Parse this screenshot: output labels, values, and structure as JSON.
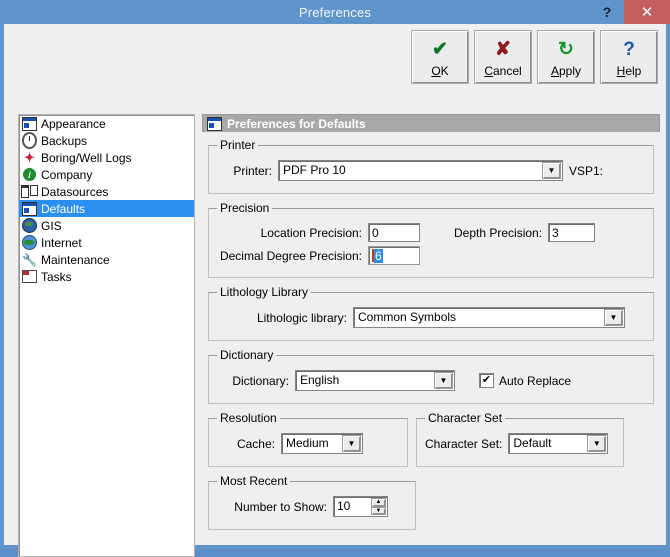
{
  "window": {
    "title": "Preferences",
    "help_glyph": "?",
    "close_glyph": "✕",
    "accent_title_bg": "#6094cb",
    "close_bg": "#c45f5f"
  },
  "toolbar": {
    "buttons": [
      {
        "name": "ok",
        "glyph": "✔",
        "pre": "O",
        "accel": "K",
        "post": "",
        "color": "#0a7a28"
      },
      {
        "name": "cancel",
        "glyph": "✘",
        "pre": "",
        "accel": "C",
        "post": "ancel",
        "color": "#8e1b1b"
      },
      {
        "name": "apply",
        "glyph": "↻",
        "pre": "",
        "accel": "A",
        "post": "pply",
        "color": "#18962f"
      },
      {
        "name": "help",
        "glyph": "?",
        "pre": "",
        "accel": "H",
        "post": "elp",
        "color": "#1b56b8"
      }
    ],
    "labels": {
      "ok": "OK",
      "cancel": "Cancel",
      "apply": "Apply",
      "help": "Help"
    }
  },
  "sidebar": {
    "selected": "Defaults",
    "selection_color": "#2a8fef",
    "items": [
      {
        "label": "Appearance",
        "icon": "window-icon"
      },
      {
        "label": "Backups",
        "icon": "clock-icon"
      },
      {
        "label": "Boring/Well Logs",
        "icon": "star-icon"
      },
      {
        "label": "Company",
        "icon": "info-circle-icon"
      },
      {
        "label": "Datasources",
        "icon": "datasources-icon"
      },
      {
        "label": "Defaults",
        "icon": "window-icon"
      },
      {
        "label": "GIS",
        "icon": "globe-icon"
      },
      {
        "label": "Internet",
        "icon": "globe-internet-icon"
      },
      {
        "label": "Maintenance",
        "icon": "wrench-icon"
      },
      {
        "label": "Tasks",
        "icon": "task-icon"
      }
    ]
  },
  "panel": {
    "header": "Preferences for Defaults",
    "printer": {
      "legend": "Printer",
      "label": "Printer:",
      "value": "PDF Pro 10",
      "port": "VSP1:"
    },
    "precision": {
      "legend": "Precision",
      "location_label": "Location Precision:",
      "location_value": "0",
      "depth_label": "Depth Precision:",
      "depth_value": "3",
      "decimal_label": "Decimal Degree Precision:",
      "decimal_value": "6"
    },
    "lithology": {
      "legend": "Lithology Library",
      "label": "Lithologic library:",
      "value": "Common Symbols"
    },
    "dictionary": {
      "legend": "Dictionary",
      "label": "Dictionary:",
      "value": "English",
      "auto_replace_label": "Auto Replace",
      "auto_replace_checked": "✔"
    },
    "resolution": {
      "legend": "Resolution",
      "label": "Cache:",
      "value": "Medium"
    },
    "character_set": {
      "legend": "Character Set",
      "label": "Character Set:",
      "value": "Default"
    },
    "most_recent": {
      "legend": "Most Recent",
      "label": "Number to Show:",
      "value": "10",
      "up_glyph": "▲",
      "down_glyph": "▼"
    },
    "dropdown_arrow": "▼"
  }
}
